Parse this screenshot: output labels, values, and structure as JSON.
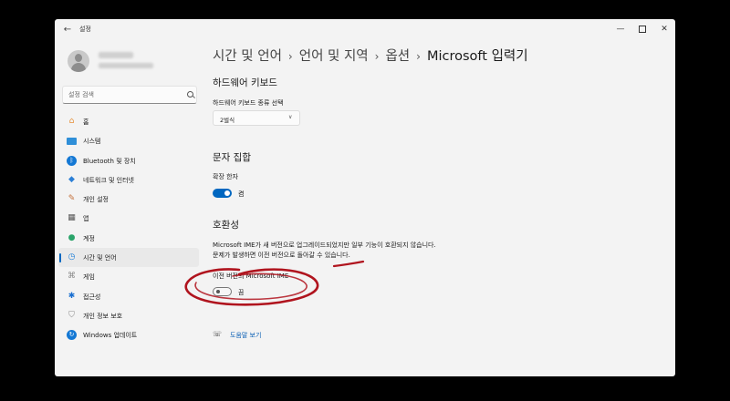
{
  "window": {
    "title": "설정",
    "back_icon": "back-arrow-icon",
    "controls": {
      "minimize": "—",
      "close": "✕"
    }
  },
  "sidebar": {
    "search_placeholder": "설정 검색",
    "items": [
      {
        "label": "홈",
        "icon": "home-icon"
      },
      {
        "label": "시스템",
        "icon": "system-icon"
      },
      {
        "label": "Bluetooth 및 장치",
        "icon": "bluetooth-icon"
      },
      {
        "label": "네트워크 및 인터넷",
        "icon": "network-icon"
      },
      {
        "label": "개인 설정",
        "icon": "personalization-icon"
      },
      {
        "label": "앱",
        "icon": "apps-icon"
      },
      {
        "label": "계정",
        "icon": "accounts-icon"
      },
      {
        "label": "시간 및 언어",
        "icon": "time-language-icon",
        "selected": true
      },
      {
        "label": "게임",
        "icon": "gaming-icon"
      },
      {
        "label": "접근성",
        "icon": "accessibility-icon"
      },
      {
        "label": "개인 정보 보호",
        "icon": "privacy-icon"
      },
      {
        "label": "Windows 업데이트",
        "icon": "windows-update-icon"
      }
    ]
  },
  "breadcrumb": {
    "items": [
      "시간 및 언어",
      "언어 및 지역",
      "옵션",
      "Microsoft 입력기"
    ],
    "separator": "›"
  },
  "hardware_keyboard": {
    "title": "하드웨어 키보드",
    "label": "하드웨어 키보드 종류 선택",
    "selected": "2벌식"
  },
  "character_set": {
    "title": "문자 집합",
    "label": "확장 한자",
    "toggle_state": "켬",
    "toggle_on": true
  },
  "compatibility": {
    "title": "호환성",
    "description": "Microsoft IME가 새 버전으로 업그레이드되었지만 일부 기능이 호환되지 않습니다. 문제가 발생하면 이전 버전으로 돌아갈 수 있습니다.",
    "label": "이전 버전의 Microsoft IME",
    "toggle_state": "끔",
    "toggle_on": false
  },
  "help": {
    "label": "도움말 보기",
    "icon": "help-icon"
  },
  "colors": {
    "accent": "#0067c0",
    "annotation": "#b0141e",
    "window_bg": "#f3f3f3"
  }
}
